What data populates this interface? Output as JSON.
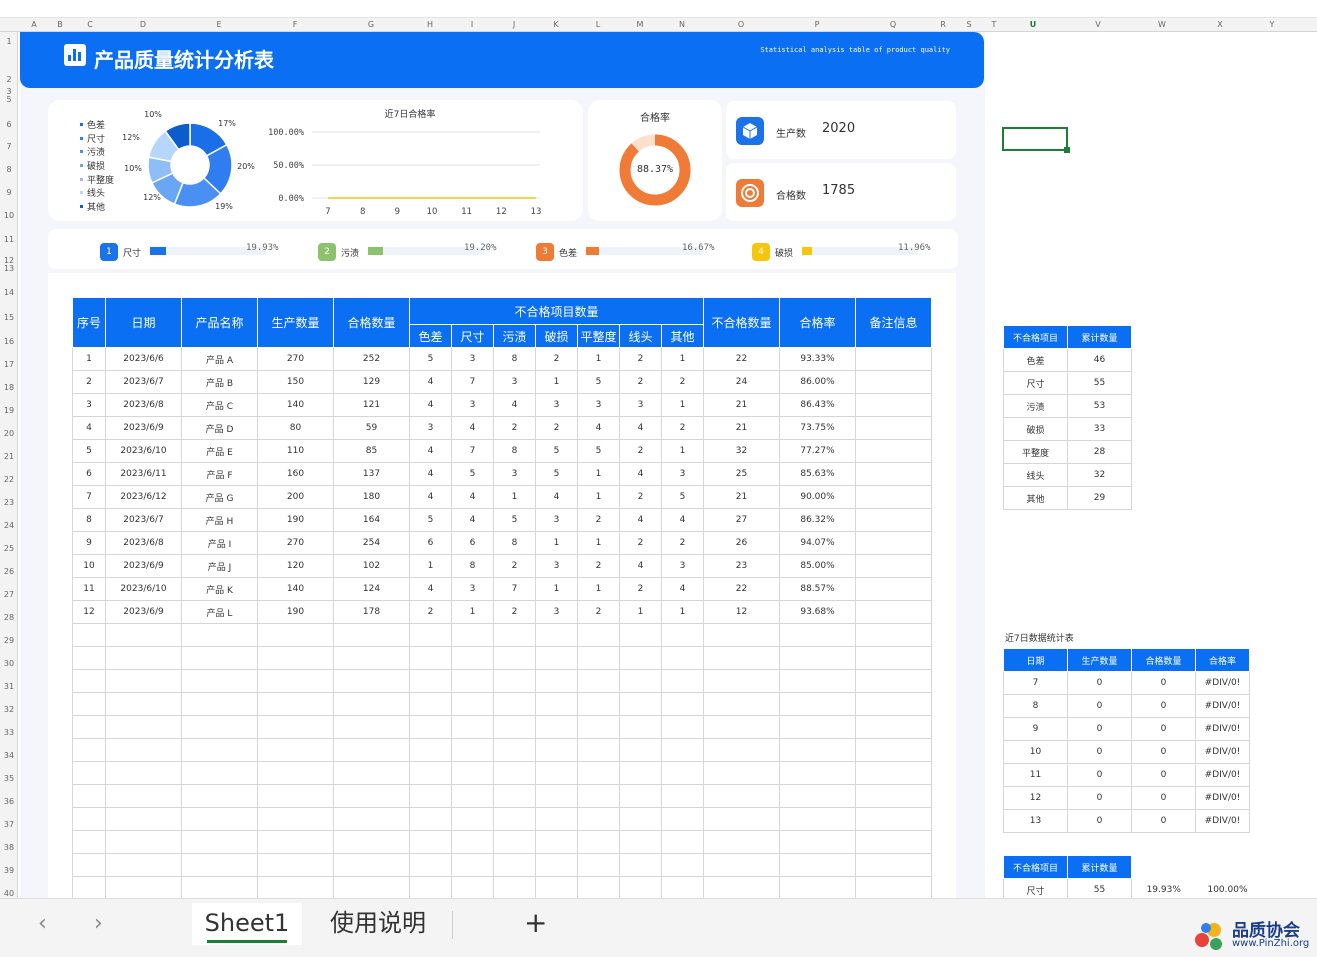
{
  "columns": [
    "A",
    "B",
    "C",
    "D",
    "E",
    "F",
    "G",
    "H",
    "I",
    "J",
    "K",
    "L",
    "M",
    "N",
    "O",
    "P",
    "Q",
    "R",
    "S",
    "T",
    "U",
    "V",
    "W",
    "X",
    "Y"
  ],
  "selected_column": "U",
  "rows": [
    "1",
    "2",
    "3",
    "5",
    "6",
    "7",
    "8",
    "9",
    "10",
    "11",
    "12",
    "13",
    "14",
    "15",
    "16",
    "17",
    "18",
    "19",
    "20",
    "21",
    "22",
    "23",
    "24",
    "25",
    "26",
    "27",
    "28",
    "29",
    "30",
    "31",
    "32",
    "33",
    "34",
    "35",
    "36",
    "37",
    "38",
    "39",
    "40"
  ],
  "banner": {
    "title": "产品质量统计分析表",
    "subtitle": "Statistical analysis table of product quality"
  },
  "donut_legend": [
    "色差",
    "尺寸",
    "污渍",
    "破损",
    "平整度",
    "线头",
    "其他"
  ],
  "donut_colors": [
    "#1a6ee8",
    "#2f7df0",
    "#4a90f3",
    "#6aa6f6",
    "#8fbdf8",
    "#b7d6fb",
    "#0c5ccc"
  ],
  "donut_chart": {
    "slices": [
      {
        "name": "色差",
        "percent": 17
      },
      {
        "name": "尺寸",
        "percent": 20
      },
      {
        "name": "污渍",
        "percent": 19
      },
      {
        "name": "破损",
        "percent": 12
      },
      {
        "name": "平整度",
        "percent": 10
      },
      {
        "name": "线头",
        "percent": 12
      },
      {
        "name": "其他",
        "percent": 10
      }
    ],
    "labels": [
      "17%",
      "20%",
      "19%",
      "12%",
      "10%",
      "12%",
      "10%"
    ]
  },
  "chart_data": {
    "type": "line",
    "title": "近7日合格率",
    "x": [
      "7",
      "8",
      "9",
      "10",
      "11",
      "12",
      "13"
    ],
    "y_ticks": [
      "100.00%",
      "50.00%",
      "0.00%"
    ],
    "ylim": [
      0,
      1
    ],
    "series": [
      {
        "values": [
          0,
          0,
          0,
          0,
          0,
          0,
          0
        ]
      }
    ]
  },
  "pass_rate": {
    "title": "合格率",
    "value_text": "88.37%",
    "value": 0.8837
  },
  "stats": {
    "produce_label": "生产数",
    "produce_value": "2020",
    "pass_label": "合格数",
    "pass_value": "1785"
  },
  "progress": [
    {
      "num": "1",
      "label": "尺寸",
      "pct": "19.93%",
      "value": 0.1993,
      "color": "#1a73e8"
    },
    {
      "num": "2",
      "label": "污渍",
      "pct": "19.20%",
      "value": 0.192,
      "color": "#8bc26b"
    },
    {
      "num": "3",
      "label": "色差",
      "pct": "16.67%",
      "value": 0.1667,
      "color": "#f07b36"
    },
    {
      "num": "4",
      "label": "破损",
      "pct": "11.96%",
      "value": 0.1196,
      "color": "#f6c60a"
    }
  ],
  "main_table": {
    "headers": {
      "seq": "序号",
      "date": "日期",
      "product": "产品名称",
      "qty": "生产数量",
      "good": "合格数量",
      "defect_group": "不合格项目数量",
      "bad": "不合格数量",
      "rate": "合格率",
      "note": "备注信息"
    },
    "defect_cols": [
      "色差",
      "尺寸",
      "污渍",
      "破损",
      "平整度",
      "线头",
      "其他"
    ],
    "rows": [
      [
        "1",
        "2023/6/6",
        "产品 A",
        "270",
        "252",
        "5",
        "3",
        "8",
        "2",
        "1",
        "2",
        "1",
        "22",
        "93.33%",
        ""
      ],
      [
        "2",
        "2023/6/7",
        "产品 B",
        "150",
        "129",
        "4",
        "7",
        "3",
        "1",
        "5",
        "2",
        "2",
        "24",
        "86.00%",
        ""
      ],
      [
        "3",
        "2023/6/8",
        "产品 C",
        "140",
        "121",
        "4",
        "3",
        "4",
        "3",
        "3",
        "3",
        "1",
        "21",
        "86.43%",
        ""
      ],
      [
        "4",
        "2023/6/9",
        "产品 D",
        "80",
        "59",
        "3",
        "4",
        "2",
        "2",
        "4",
        "4",
        "2",
        "21",
        "73.75%",
        ""
      ],
      [
        "5",
        "2023/6/10",
        "产品 E",
        "110",
        "85",
        "4",
        "7",
        "8",
        "5",
        "5",
        "2",
        "1",
        "32",
        "77.27%",
        ""
      ],
      [
        "6",
        "2023/6/11",
        "产品 F",
        "160",
        "137",
        "4",
        "5",
        "3",
        "5",
        "1",
        "4",
        "3",
        "25",
        "85.63%",
        ""
      ],
      [
        "7",
        "2023/6/12",
        "产品 G",
        "200",
        "180",
        "4",
        "4",
        "1",
        "4",
        "1",
        "2",
        "5",
        "21",
        "90.00%",
        ""
      ],
      [
        "8",
        "2023/6/7",
        "产品 H",
        "190",
        "164",
        "5",
        "4",
        "5",
        "3",
        "2",
        "4",
        "4",
        "27",
        "86.32%",
        ""
      ],
      [
        "9",
        "2023/6/8",
        "产品 I",
        "270",
        "254",
        "6",
        "6",
        "8",
        "1",
        "1",
        "2",
        "2",
        "26",
        "94.07%",
        ""
      ],
      [
        "10",
        "2023/6/9",
        "产品 J",
        "120",
        "102",
        "1",
        "8",
        "2",
        "3",
        "2",
        "4",
        "3",
        "23",
        "85.00%",
        ""
      ],
      [
        "11",
        "2023/6/10",
        "产品 K",
        "140",
        "124",
        "4",
        "3",
        "7",
        "1",
        "1",
        "2",
        "4",
        "22",
        "88.57%",
        ""
      ],
      [
        "12",
        "2023/6/9",
        "产品 L",
        "190",
        "178",
        "2",
        "1",
        "2",
        "3",
        "2",
        "1",
        "1",
        "12",
        "93.68%",
        ""
      ]
    ],
    "empty_rows": 12
  },
  "side_table1": {
    "headers": [
      "不合格项目",
      "累计数量"
    ],
    "rows": [
      [
        "色差",
        "46"
      ],
      [
        "尺寸",
        "55"
      ],
      [
        "污渍",
        "53"
      ],
      [
        "破损",
        "33"
      ],
      [
        "平整度",
        "28"
      ],
      [
        "线头",
        "32"
      ],
      [
        "其他",
        "29"
      ]
    ]
  },
  "side_table2": {
    "caption": "近7日数据统计表",
    "headers": [
      "日期",
      "生产数量",
      "合格数量",
      "合格率"
    ],
    "rows": [
      [
        "7",
        "0",
        "0",
        "#DIV/0!"
      ],
      [
        "8",
        "0",
        "0",
        "#DIV/0!"
      ],
      [
        "9",
        "0",
        "0",
        "#DIV/0!"
      ],
      [
        "10",
        "0",
        "0",
        "#DIV/0!"
      ],
      [
        "11",
        "0",
        "0",
        "#DIV/0!"
      ],
      [
        "12",
        "0",
        "0",
        "#DIV/0!"
      ],
      [
        "13",
        "0",
        "0",
        "#DIV/0!"
      ]
    ]
  },
  "side_table3": {
    "headers": [
      "不合格项目",
      "累计数量"
    ],
    "rows": [
      [
        "尺寸",
        "55",
        "19.93%",
        "100.00%"
      ]
    ]
  },
  "tabs": {
    "prev": "‹",
    "next": "›",
    "sheet1": "Sheet1",
    "sheet2": "使用说明",
    "add": "+"
  },
  "logo": {
    "name": "品质协会",
    "url": "www.PinZhi.org"
  }
}
